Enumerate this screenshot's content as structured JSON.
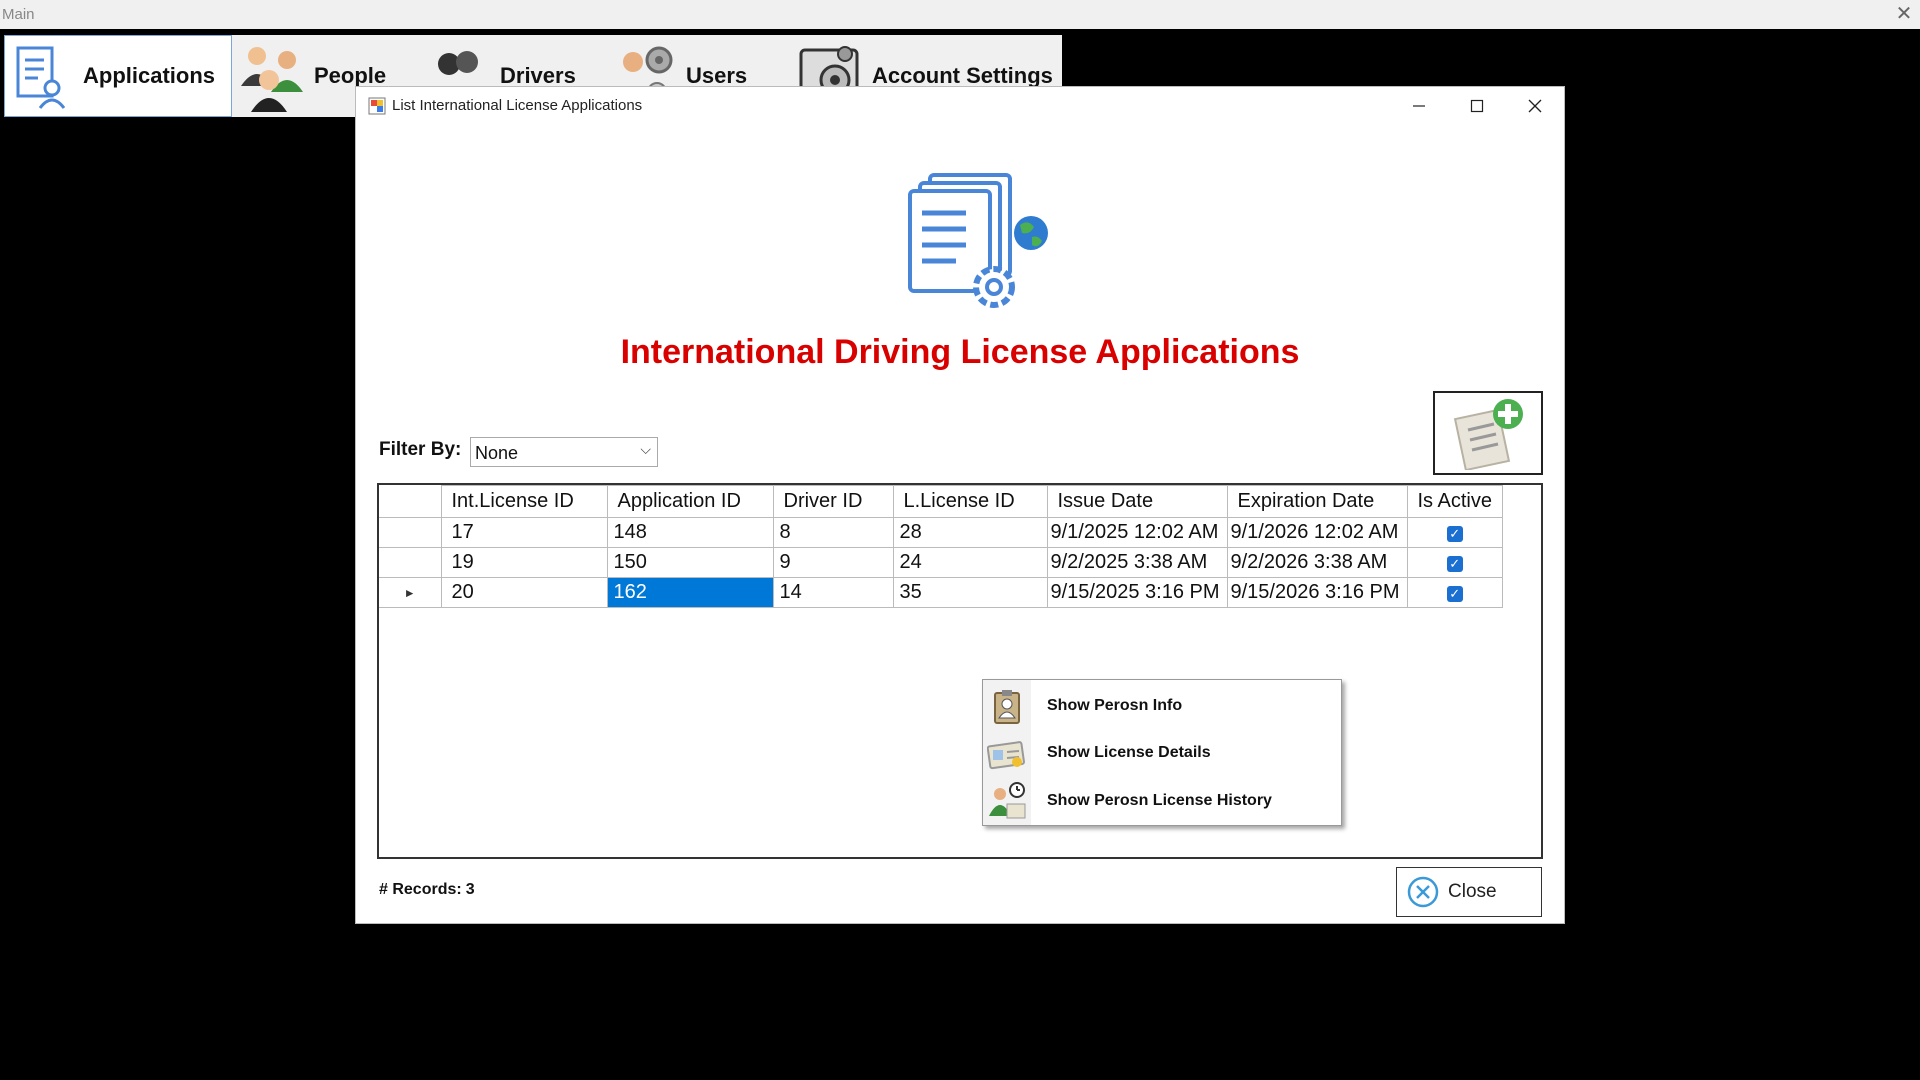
{
  "main_window": {
    "title": "Main"
  },
  "menu": {
    "items": [
      {
        "label": "Applications",
        "icon": "applications-icon",
        "active": true
      },
      {
        "label": "People",
        "icon": "people-icon"
      },
      {
        "label": "Drivers",
        "icon": "drivers-icon"
      },
      {
        "label": "Users",
        "icon": "users-icon"
      },
      {
        "label": "Account Settings",
        "icon": "account-settings-icon"
      }
    ]
  },
  "dialog": {
    "title": "List International License Applications",
    "heading": "International Driving License Applications",
    "heading_color": "#d90000",
    "filter": {
      "label": "Filter By:",
      "selected": "None"
    },
    "grid": {
      "columns": [
        "Int.License ID",
        "Application ID",
        "Driver ID",
        "L.License ID",
        "Issue Date",
        "Expiration Date",
        "Is Active"
      ],
      "rows": [
        {
          "int_license_id": "17",
          "application_id": "148",
          "driver_id": "8",
          "l_license_id": "28",
          "issue_date": "9/1/2025 12:02 AM",
          "expiration_date": "9/1/2026 12:02 AM",
          "is_active": true
        },
        {
          "int_license_id": "19",
          "application_id": "150",
          "driver_id": "9",
          "l_license_id": "24",
          "issue_date": "9/2/2025 3:38 AM",
          "expiration_date": "9/2/2026 3:38 AM",
          "is_active": true
        },
        {
          "int_license_id": "20",
          "application_id": "162",
          "driver_id": "14",
          "l_license_id": "35",
          "issue_date": "9/15/2025 3:16 PM",
          "expiration_date": "9/15/2026 3:16 PM",
          "is_active": true
        }
      ],
      "selected_row_marker": "►",
      "selection_color": "#0078d7"
    },
    "context_menu": {
      "items": [
        {
          "label": "Show Perosn Info",
          "icon": "person-card-icon"
        },
        {
          "label": "Show License Details",
          "icon": "license-card-icon"
        },
        {
          "label": "Show Perosn License History",
          "icon": "license-history-icon"
        }
      ]
    },
    "records": {
      "label": "# Records:",
      "count": "3"
    },
    "close_button": {
      "label": "Close"
    }
  }
}
